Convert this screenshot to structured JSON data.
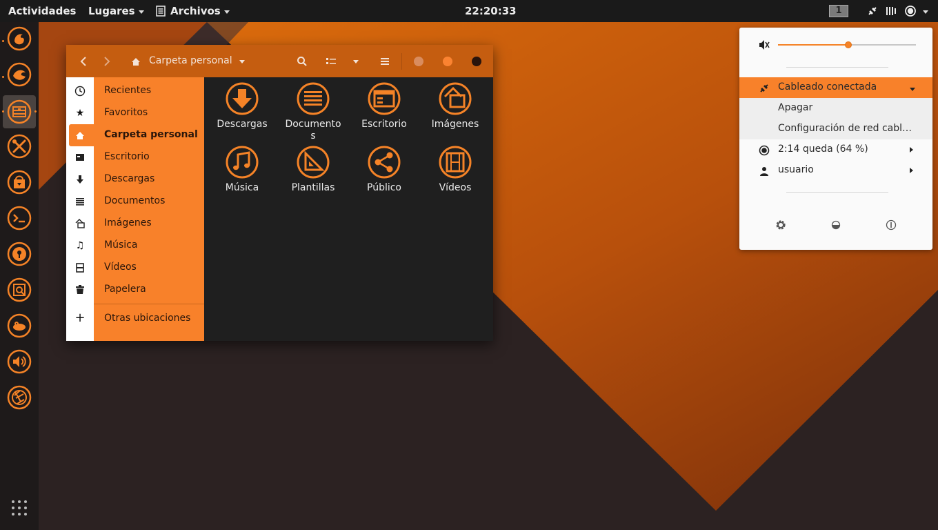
{
  "colors": {
    "accent": "#f58327",
    "header": "#c55d10",
    "sidebar": "#f8812a",
    "topbar": "#1a1a1a",
    "panel": "#fafafa"
  },
  "topbar": {
    "activities": "Actividades",
    "places": "Lugares",
    "files_app": "Archivos",
    "clock": "22:20:33",
    "workspace": "1",
    "indicators": [
      "network-wired-icon",
      "sound-icon",
      "battery-icon",
      "power-menu-caret"
    ]
  },
  "dock": {
    "items": [
      "firefox-icon",
      "thunderbird-icon",
      "files-icon",
      "settings-tools-icon",
      "software-store-icon",
      "terminal-icon",
      "password-keyring-icon",
      "image-viewer-icon",
      "gimp-icon",
      "volume-icon",
      "shutter-icon"
    ],
    "show_apps": "app-grid-icon"
  },
  "files": {
    "path": "Carpeta personal",
    "sidebar": [
      {
        "label": "Recientes",
        "icon": "clock-icon"
      },
      {
        "label": "Favoritos",
        "icon": "star-icon"
      },
      {
        "label": "Carpeta personal",
        "icon": "home-icon",
        "active": true
      },
      {
        "label": "Escritorio",
        "icon": "desktop-icon"
      },
      {
        "label": "Descargas",
        "icon": "download-icon"
      },
      {
        "label": "Documentos",
        "icon": "document-icon"
      },
      {
        "label": "Imágenes",
        "icon": "pictures-icon"
      },
      {
        "label": "Música",
        "icon": "music-icon"
      },
      {
        "label": "Vídeos",
        "icon": "video-icon"
      },
      {
        "label": "Papelera",
        "icon": "trash-icon"
      }
    ],
    "other_locations": "Otras ubicaciones",
    "folders": [
      {
        "label": "Descargas",
        "icon": "download-folder-icon"
      },
      {
        "label": "Documentos",
        "icon": "documents-folder-icon"
      },
      {
        "label": "Escritorio",
        "icon": "desktop-folder-icon"
      },
      {
        "label": "Imágenes",
        "icon": "pictures-folder-icon"
      },
      {
        "label": "Música",
        "icon": "music-folder-icon"
      },
      {
        "label": "Plantillas",
        "icon": "templates-folder-icon"
      },
      {
        "label": "Público",
        "icon": "public-folder-icon"
      },
      {
        "label": "Vídeos",
        "icon": "videos-folder-icon"
      }
    ]
  },
  "system_menu": {
    "volume_level": 0.51,
    "network": "Cableado conectada",
    "network_off": "Apagar",
    "network_settings": "Configuración de red cabl…",
    "battery": "2:14 queda (64 %)",
    "user": "usuario"
  }
}
